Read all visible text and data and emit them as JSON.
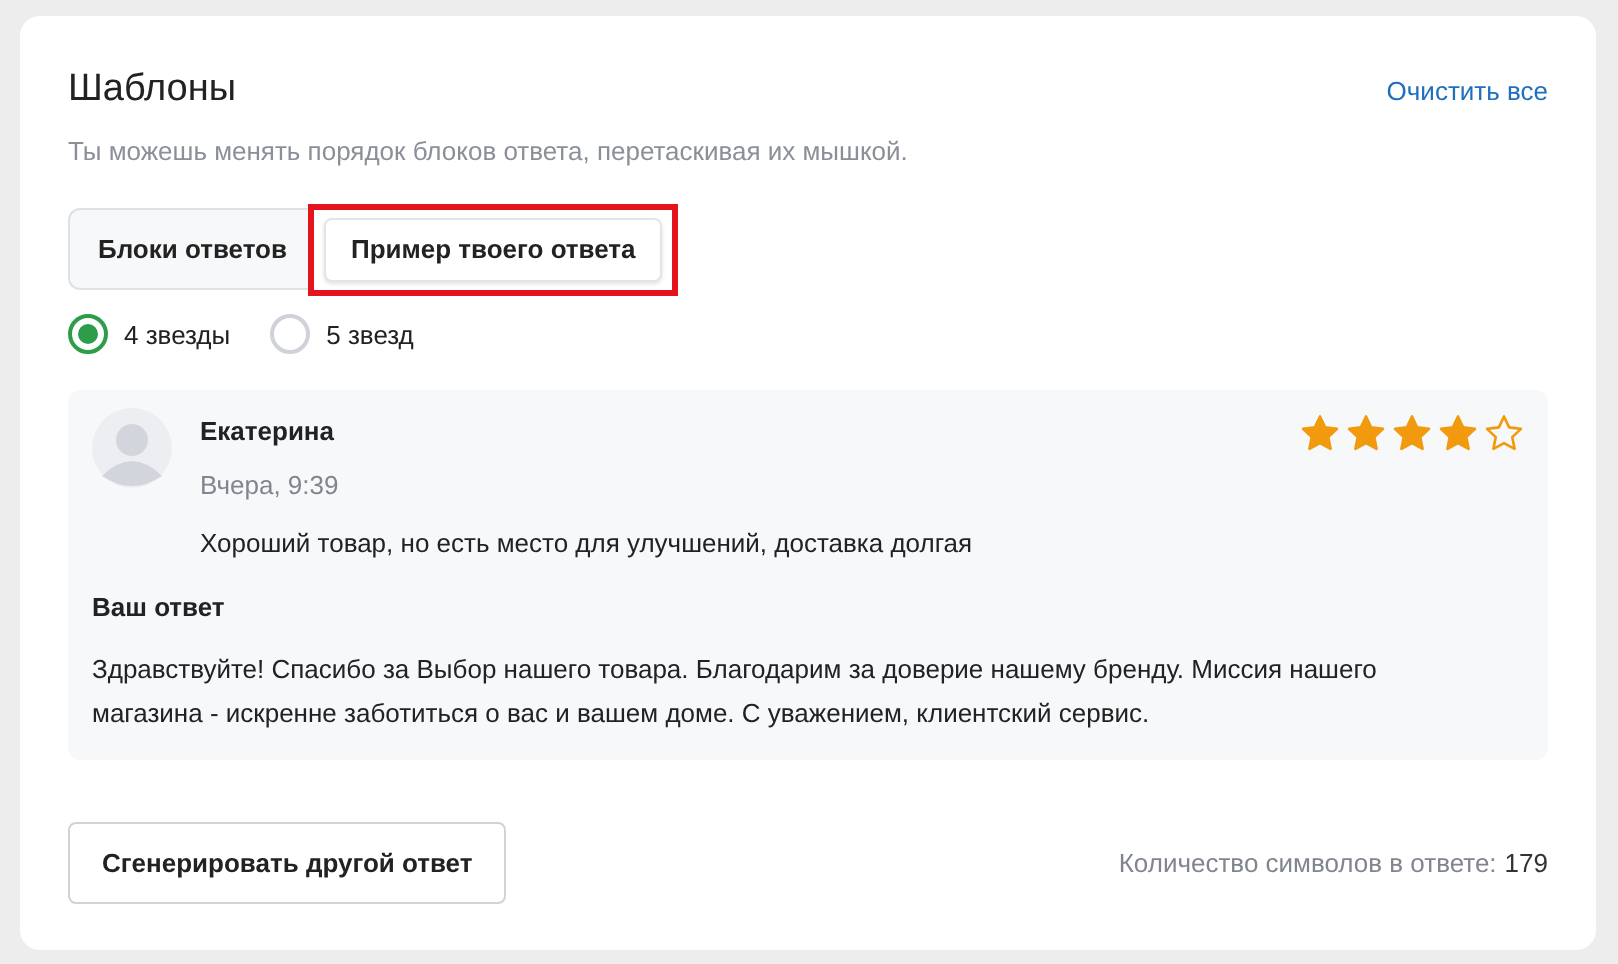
{
  "header": {
    "title": "Шаблоны",
    "clear_link": "Очистить все",
    "hint": "Ты можешь менять порядок блоков ответа, перетаскивая их мышкой."
  },
  "tabs": [
    {
      "label": "Блоки ответов",
      "selected": false,
      "highlighted": false
    },
    {
      "label": "Пример твоего ответа",
      "selected": true,
      "highlighted": true
    }
  ],
  "ratings": [
    {
      "label": "4 звезды",
      "selected": true
    },
    {
      "label": "5 звезд",
      "selected": false
    }
  ],
  "review": {
    "author": "Екатерина",
    "time": "Вчера, 9:39",
    "stars": 4,
    "text": "Хороший товар, но есть место для улучшений, доставка долгая",
    "answer_title": "Ваш ответ",
    "answer": "Здравствуйте! Спасибо за Выбор нашего товара. Благодарим за доверие нашему бренду. Миссия нашего магазина - искренне заботиться о вас и вашем доме. С уважением, клиентский сервис."
  },
  "footer": {
    "button": "Сгенерировать другой ответ",
    "count_label": "Количество символов в ответе:",
    "count_value": "179"
  }
}
